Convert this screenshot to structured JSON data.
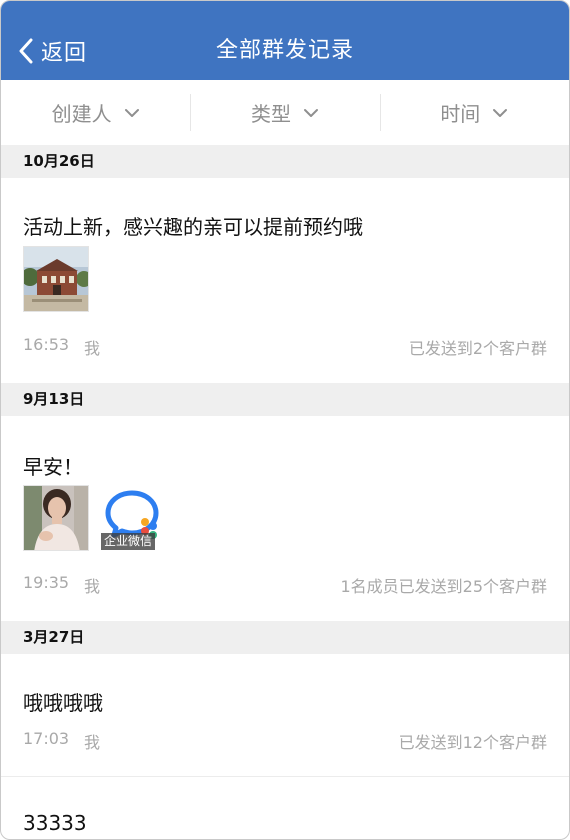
{
  "header": {
    "back_label": "返回",
    "title": "全部群发记录",
    "bg_color": "#3f74c1"
  },
  "filters": [
    {
      "label": "创建人"
    },
    {
      "label": "类型"
    },
    {
      "label": "时间"
    }
  ],
  "groups": [
    {
      "date": "10月26日",
      "message": "活动上新，感兴趣的亲可以提前预约哦",
      "attachments": [
        "building-photo"
      ],
      "time": "16:53",
      "sender": "我",
      "status": "已发送到2个客户群"
    },
    {
      "date": "9月13日",
      "message": "早安！",
      "attachments": [
        "portrait-photo",
        "wecom-logo"
      ],
      "badge": "企业微信",
      "time": "19:35",
      "sender": "我",
      "status": "1名成员已发送到25个客户群"
    },
    {
      "date": "3月27日",
      "message": "哦哦哦哦",
      "time": "17:03",
      "sender": "我",
      "status": "已发送到12个客户群"
    },
    {
      "message": "33333"
    }
  ]
}
